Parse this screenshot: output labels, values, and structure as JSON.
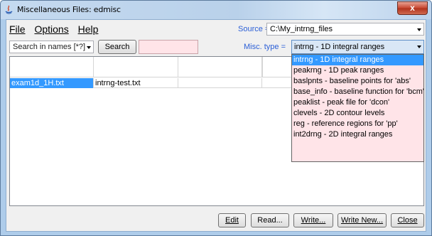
{
  "window": {
    "title": "Miscellaneous Files: edmisc",
    "close_glyph": "x"
  },
  "menu": {
    "file": "File",
    "options": "Options",
    "help": "Help"
  },
  "source": {
    "label": "Source =",
    "value": "C:\\My_intrng_files"
  },
  "search": {
    "mode": "Search in names [*?]",
    "button": "Search",
    "value": ""
  },
  "misc_type": {
    "label": "Misc. type =",
    "value": "intrng - 1D integral ranges",
    "options": [
      "intrng - 1D integral ranges",
      "peakrng - 1D peak ranges",
      "baslpnts - baseline points for 'abs'",
      "base_info - baseline function for 'bcm'",
      "peaklist - peak file for 'dcon'",
      "clevels - 2D contour levels",
      "reg - reference regions for 'pp'",
      "int2drng - 2D integral ranges"
    ]
  },
  "table": {
    "rows": [
      [
        "exam1d_1H.txt",
        "intrng-test.txt"
      ]
    ]
  },
  "buttons": {
    "edit": "Edit",
    "read": "Read...",
    "write": "Write...",
    "write_new": "Write New...",
    "close": "Close"
  }
}
